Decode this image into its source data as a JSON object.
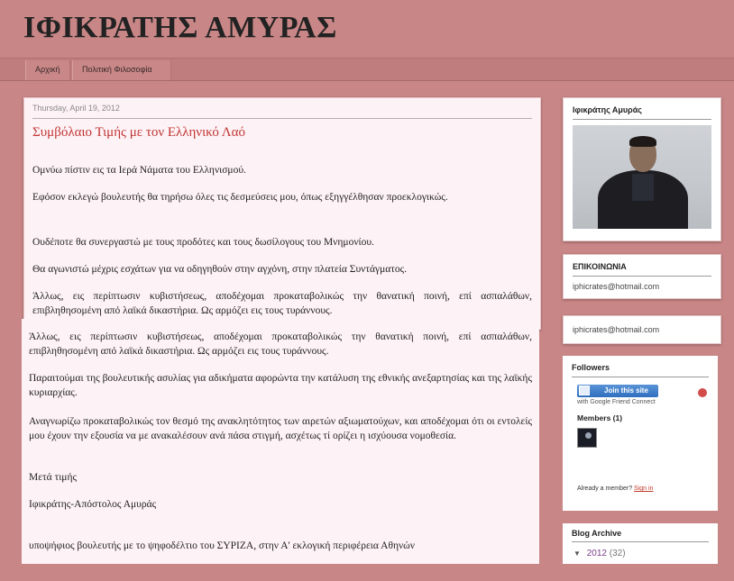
{
  "header": {
    "title": "ΙΦΙΚΡΑΤΗΣ ΑΜΥΡΑΣ"
  },
  "tabs": [
    {
      "label": "Αρχική"
    },
    {
      "label": "Πολιτική Φιλοσοφία"
    }
  ],
  "post": {
    "date": "Thursday, April 19, 2012",
    "title": "Συμβόλαιο Τιμής με τον Ελληνικό Λαό",
    "paragraphs": [
      "Ομνύω πίστιν εις τα Ιερά Νάματα του Ελληνισμού.",
      "Εφόσον εκλεγώ βουλευτής θα τηρήσω όλες τις δεσμεύσεις μου, όπως εξηγγέλθησαν προεκλογικώς.",
      "Ουδέποτε θα συνεργαστώ με τους προδότες και τους δωσίλογους του Μνημονίου.",
      "Θα αγωνιστώ μέχρις εσχάτων για να οδηγηθούν στην αγχόνη, στην πλατεία Συντάγματος.",
      "Άλλως, εις περίπτωσιν κυβιστήσεως, αποδέχομαι προκαταβολικώς την θανατική ποινή, επί ασπαλάθων, επιβληθησομένη από λαϊκά δικαστήρια. Ως αρμόζει εις τους τυράννους."
    ],
    "continuation": [
      "Άλλως, εις περίπτωσιν κυβιστήσεως, αποδέχομαι προκαταβολικώς την θανατική ποινή, επί ασπαλάθων, επιβληθησομένη από λαϊκά δικαστήρια. Ως αρμόζει εις τους τυράννους.",
      "Παραιτούμαι της βουλευτικής ασυλίας για αδικήματα αφορώντα την κατάλυση της εθνικής ανεξαρτησίας και της λαϊκής κυριαρχίας.",
      "Αναγνωρίζω προκαταβολικώς τον θεσμό της ανακλητότητος των αιρετών αξιωματούχων, και αποδέχομαι ότι οι εντολείς μου έχουν την εξουσία να με ανακαλέσουν ανά πάσα στιγμή, ασχέτως τί ορίζει η ισχύουσα νομοθεσία.",
      "Μετά τιμής",
      "Ιφικράτης-Απόστολος Αμυράς",
      "υποψήφιος βουλευτής με το ψηφοδέλτιο του ΣΥΡΙΖΑ, στην Α' εκλογική περιφέρεια Αθηνών"
    ]
  },
  "sidebar": {
    "profile": {
      "heading": "Ιφικράτης Αμυράς"
    },
    "contact": {
      "heading": "ΕΠΙΚΟΙΝΩΝΙΑ",
      "email": "iphicrates@hotmail.com"
    },
    "contact_repeat": {
      "email": "iphicrates@hotmail.com"
    },
    "followers": {
      "heading": "Followers",
      "join_label": "Join this site",
      "gfc_label": "with Google Friend Connect",
      "members_label": "Members (1)",
      "already_label": "Already a member?",
      "signin_label": "Sign in"
    },
    "archive": {
      "heading": "Blog Archive",
      "year": "2012",
      "count": "(32)",
      "toggle": "▼"
    }
  }
}
